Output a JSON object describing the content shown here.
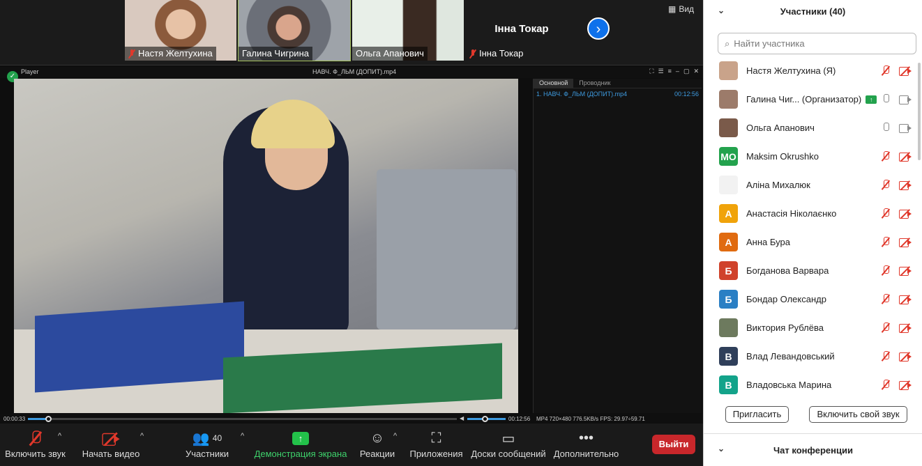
{
  "top_strip": {
    "tiles": [
      {
        "name": "Настя Желтухина",
        "muted": true
      },
      {
        "name": "Галина Чигрина",
        "muted": false
      },
      {
        "name": "Ольга Апанович",
        "muted": false
      },
      {
        "name": "Інна Токар",
        "muted": true,
        "placeholder_label": "Інна Токар"
      }
    ],
    "view_label": "Вид"
  },
  "player": {
    "app_label": "Player",
    "title": "НАВЧ. Ф_ЛЬМ (ДОПИТ).mp4",
    "tabs": [
      "Основной",
      "Проводник"
    ],
    "playlist_item": {
      "name": "1. НАВЧ. Ф_ЛЬМ (ДОПИТ).mp4",
      "duration": "00:12:56"
    },
    "time_current": "00:00:33",
    "time_total": "00:12:56",
    "media_info": "MP4  720×480  776.5KB/s  FPS: 29.97÷59.71",
    "progress_fraction": 0.045
  },
  "toolbar": {
    "unmute": "Включить звук",
    "start_video": "Начать видео",
    "participants": "Участники",
    "participants_count": "40",
    "share_screen": "Демонстрация экрана",
    "reactions": "Реакции",
    "apps": "Приложения",
    "whiteboards": "Доски сообщений",
    "more": "Дополнительно",
    "leave": "Выйти"
  },
  "panel": {
    "title": "Участники (40)",
    "search_placeholder": "Найти участника",
    "participants": [
      {
        "name": "Настя Желтухина (Я)",
        "initials": "",
        "color": "#c9a38a",
        "mic_muted": true,
        "cam_off": true
      },
      {
        "name": "Галина Чиг... (Организатор)",
        "initials": "",
        "color": "#9c7b6a",
        "mic_muted": false,
        "cam_off": false,
        "badge": true
      },
      {
        "name": "Ольга Апанович",
        "initials": "",
        "color": "#7a5a4a",
        "mic_muted": false,
        "cam_off": false
      },
      {
        "name": "Maksim Okrushko",
        "initials": "MO",
        "color": "#23a24d",
        "mic_muted": true,
        "cam_off": true
      },
      {
        "name": "Аліна Михалюк",
        "initials": "",
        "color": "#f2f2f2",
        "mic_muted": true,
        "cam_off": true
      },
      {
        "name": "Анастасія Ніколаєнко",
        "initials": "А",
        "color": "#f0a30a",
        "mic_muted": true,
        "cam_off": true
      },
      {
        "name": "Анна Бура",
        "initials": "А",
        "color": "#e06b10",
        "mic_muted": true,
        "cam_off": true
      },
      {
        "name": "Богданова Варвара",
        "initials": "Б",
        "color": "#d0422b",
        "mic_muted": true,
        "cam_off": true
      },
      {
        "name": "Бондар Олександр",
        "initials": "Б",
        "color": "#2a7fc4",
        "mic_muted": true,
        "cam_off": true
      },
      {
        "name": "Виктория Рублёва",
        "initials": "",
        "color": "#6d7a5e",
        "mic_muted": true,
        "cam_off": true
      },
      {
        "name": "Влад Левандовський",
        "initials": "В",
        "color": "#2f3f5a",
        "mic_muted": true,
        "cam_off": true
      },
      {
        "name": "Владовська Марина",
        "initials": "В",
        "color": "#13a38a",
        "mic_muted": true,
        "cam_off": true
      }
    ],
    "invite": "Пригласить",
    "unmute_self": "Включить свой звук",
    "chat_title": "Чат конференции"
  }
}
